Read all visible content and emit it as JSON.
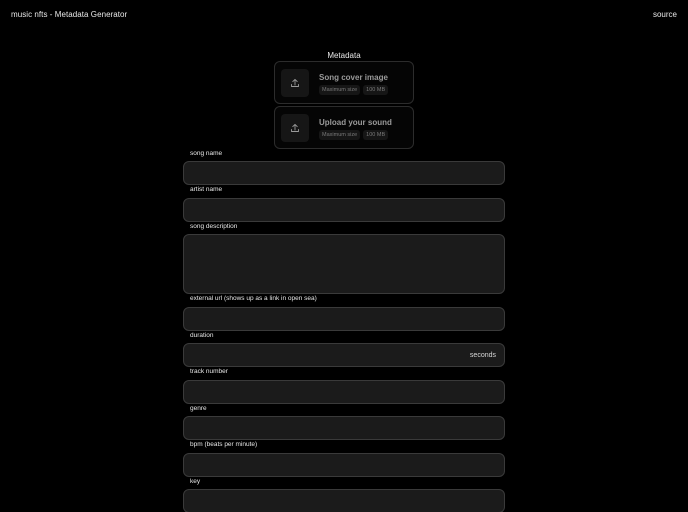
{
  "header": {
    "title": "music nfts - Metadata Generator",
    "source_label": "source"
  },
  "metadata": {
    "title": "Metadata",
    "uploads": [
      {
        "title": "Song cover image",
        "size_label": "Maximum size",
        "size_value": "100 MB",
        "icon": "upload-icon"
      },
      {
        "title": "Upload your sound",
        "size_label": "Maximum size",
        "size_value": "100 MB",
        "icon": "upload-icon"
      }
    ]
  },
  "form": {
    "song_name": {
      "label": "song name",
      "value": ""
    },
    "artist_name": {
      "label": "artist name",
      "value": ""
    },
    "song_description": {
      "label": "song description",
      "value": ""
    },
    "external_url": {
      "label": "external url (shows up as a link in open sea)",
      "value": ""
    },
    "duration": {
      "label": "duration",
      "value": "",
      "suffix": "seconds"
    },
    "track_number": {
      "label": "track number",
      "value": ""
    },
    "genre": {
      "label": "genre",
      "value": ""
    },
    "bpm": {
      "label": "bpm (beats per minute)",
      "value": ""
    },
    "key": {
      "label": "key",
      "value": ""
    }
  },
  "colors": {
    "background": "#000000",
    "field_bg": "#1b1b1b",
    "field_border": "#3a3a3a",
    "text": "#e8e8e8",
    "muted": "#9a9a9a"
  }
}
